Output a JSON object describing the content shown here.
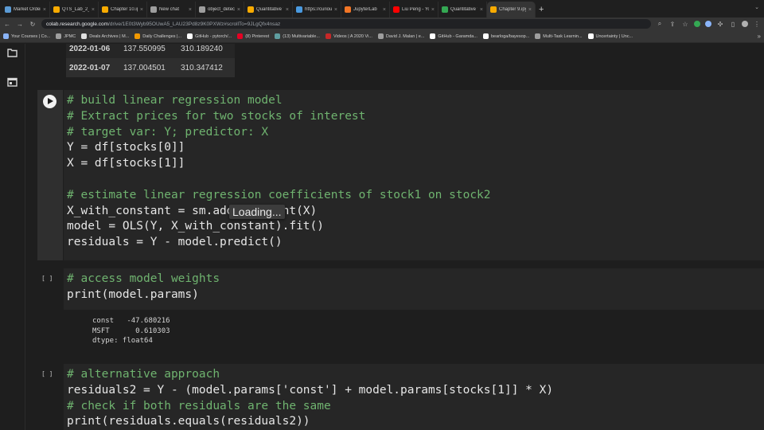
{
  "tabs": [
    {
      "label": "Market Order Exe",
      "color": "#5b9bd5"
    },
    {
      "label": "QTS_Lab_2_ans",
      "color": "#f9ab00"
    },
    {
      "label": "Chapter 10.ipynb",
      "color": "#f9ab00"
    },
    {
      "label": "New chat",
      "color": "#9e9e9e"
    },
    {
      "label": "object_detection",
      "color": "#9e9e9e"
    },
    {
      "label": "Quantitative tradi",
      "color": "#f9ab00"
    },
    {
      "label": "https://curiously",
      "color": "#4a9ae0"
    },
    {
      "label": "JupyterLab",
      "color": "#f37626"
    },
    {
      "label": "Liu Peng - YouTu",
      "color": "#ff0000"
    },
    {
      "label": "Quantitative trad",
      "color": "#34a853"
    },
    {
      "label": "Chapter 9.ipynb",
      "color": "#f9ab00",
      "active": true
    }
  ],
  "address": {
    "host": "colab.research.google.com",
    "path": "/drive/1E0t3Wyb95OUwA5_LAU23Pd8z9K0PXWz#scrollTo=9JLgQfx4nsaz"
  },
  "bookmarks": [
    {
      "label": "Your Courses | Co...",
      "color": "#8ab4f8"
    },
    {
      "label": "JPMC",
      "color": "#9e9e9e"
    },
    {
      "label": "Deals Archives | M...",
      "color": "#e0e0e0"
    },
    {
      "label": "Daily Challenges |...",
      "color": "#f29900"
    },
    {
      "label": "GitHub - pytorch/...",
      "color": "#ffffff"
    },
    {
      "label": "(8) Pinterest",
      "color": "#e60023"
    },
    {
      "label": "(13) Multivariable...",
      "color": "#5f9ea0"
    },
    {
      "label": "Videos | A 2020 Vi...",
      "color": "#c62828"
    },
    {
      "label": "David J. Malan | e...",
      "color": "#9e9e9e"
    },
    {
      "label": "GitHub - Garamda...",
      "color": "#ffffff"
    },
    {
      "label": "bearloga/bayesop...",
      "color": "#ffffff"
    },
    {
      "label": "Multi-Task Learnin...",
      "color": "#9e9e9e"
    },
    {
      "label": "Uncertainty | Unc...",
      "color": "#ffffff"
    }
  ],
  "prev_output": {
    "rows": [
      [
        "2022-01-06",
        "137.550995",
        "310.189240"
      ],
      [
        "2022-01-07",
        "137.004501",
        "310.347412"
      ]
    ]
  },
  "cell1": {
    "lines": [
      "# build linear regression model",
      "# Extract prices for two stocks of interest",
      "# target var: Y; predictor: X",
      "Y = df[stocks[0]]",
      "X = df[stocks[1]]",
      "",
      "# estimate linear regression coefficients of stock1 on stock2",
      "X_with_constant = sm.add_constant(X)",
      "model = OLS(Y, X_with_constant).fit()",
      "residuals = Y - model.predict()"
    ],
    "tooltip": "Loading..."
  },
  "cell2": {
    "prompt": "[ ]",
    "lines": [
      "# access model weights",
      "print(model.params)"
    ],
    "output": "const   -47.680216\nMSFT      0.610303\ndtype: float64"
  },
  "cell3": {
    "prompt": "[ ]",
    "lines": [
      "# alternative approach",
      "residuals2 = Y - (model.params['const'] + model.params[stocks[1]] * X)",
      "# check if both residuals are the same",
      "print(residuals.equals(residuals2))"
    ]
  }
}
